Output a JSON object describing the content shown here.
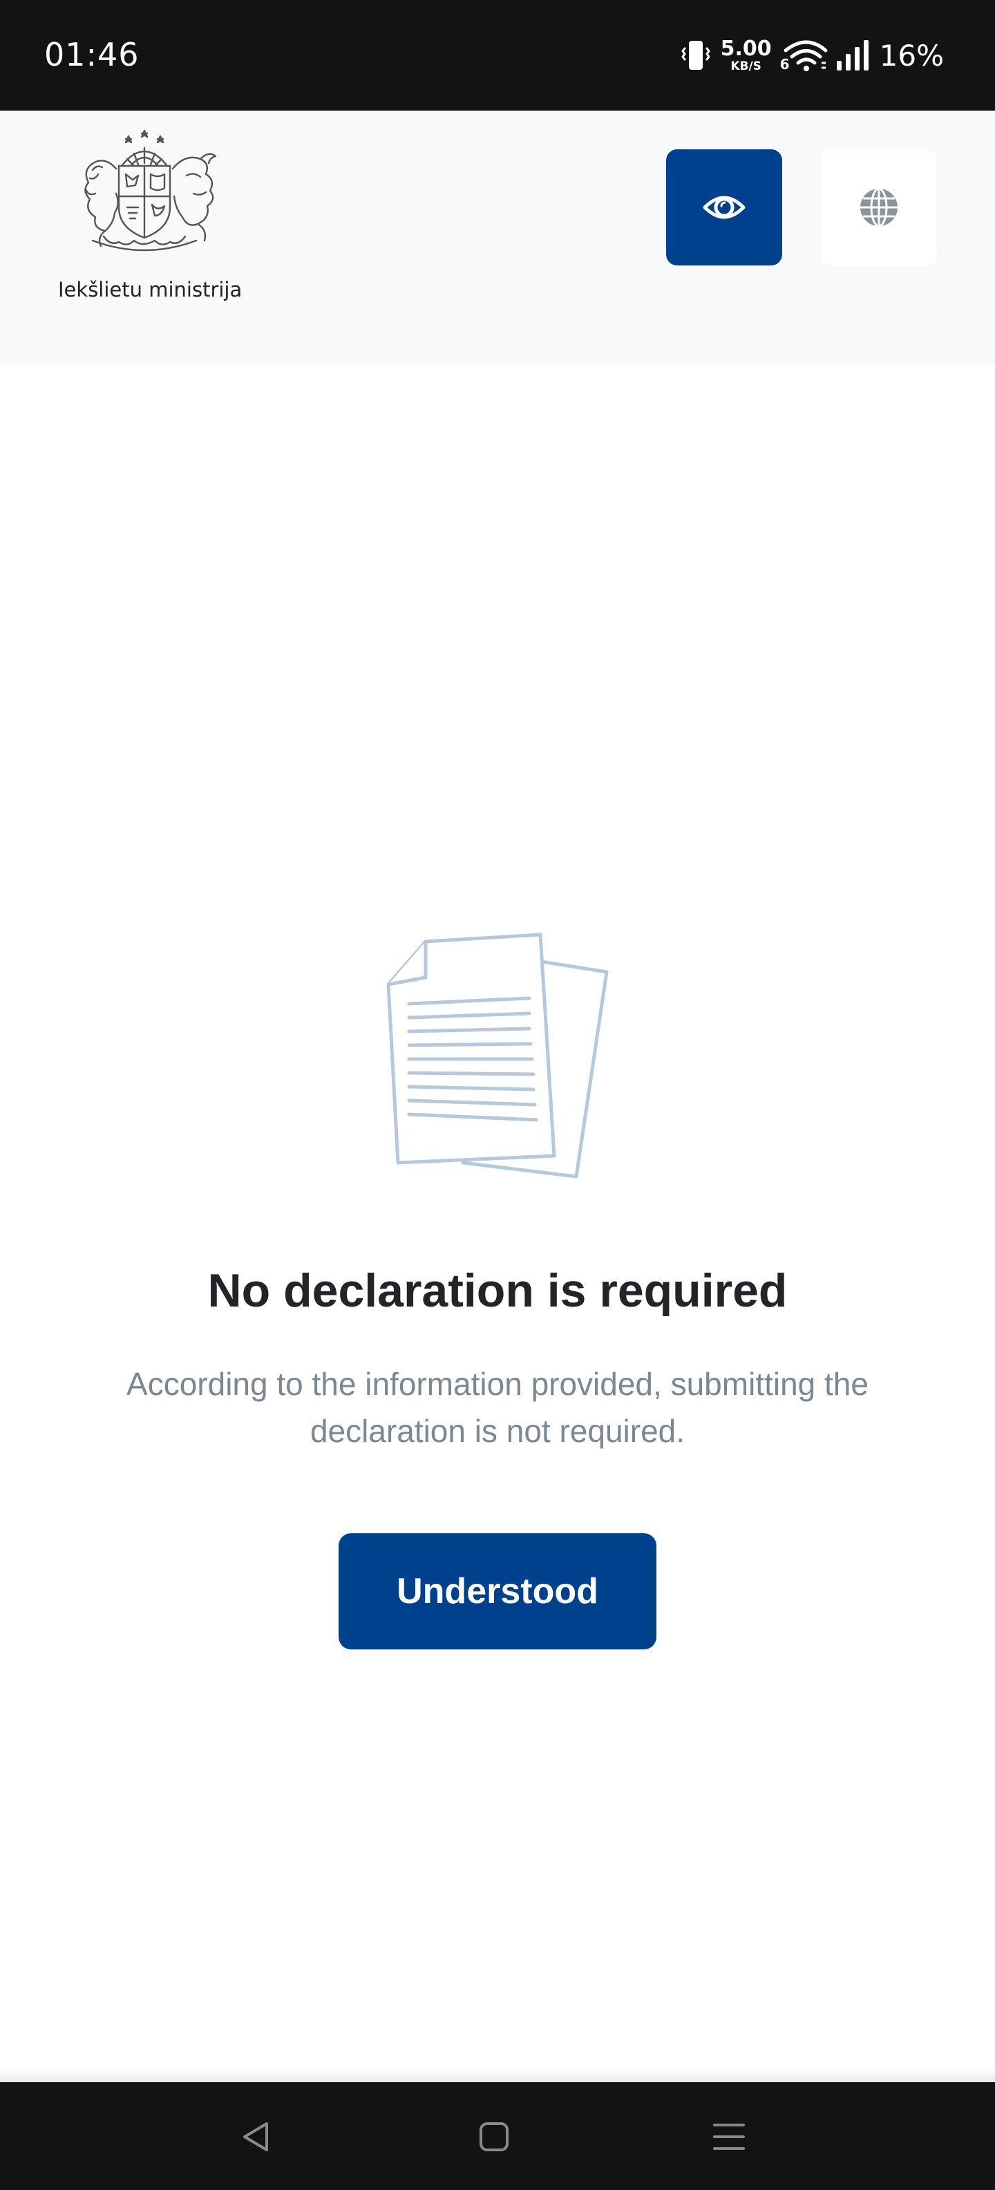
{
  "status_bar": {
    "time": "01:46",
    "net_speed_value": "5.00",
    "net_speed_unit": "KB/S",
    "wifi_badge": "6",
    "battery_percent": "16%",
    "icons": [
      "vibrate-icon",
      "wifi-icon",
      "signal-icon"
    ]
  },
  "header": {
    "brand_name": "Iekšlietu ministrija",
    "logo_icon": "coat-of-arms-icon",
    "buttons": [
      {
        "name": "visibility-button",
        "icon": "eye-icon",
        "color": "#00418d"
      },
      {
        "name": "language-button",
        "icon": "globe-icon",
        "color": "#ffffff"
      }
    ]
  },
  "main": {
    "illustration_icon": "documents-icon",
    "title": "No declaration is required",
    "description": "According to the information provided, submitting the declaration is not required.",
    "primary_button_label": "Understood"
  },
  "nav_bar": {
    "icons": [
      "back-icon",
      "home-icon",
      "recents-icon"
    ]
  },
  "colors": {
    "primary": "#00418d",
    "header_bg": "#f7f9fb",
    "title_text": "#222427",
    "body_text": "#7d8791",
    "illustration": "#b6c8db"
  }
}
